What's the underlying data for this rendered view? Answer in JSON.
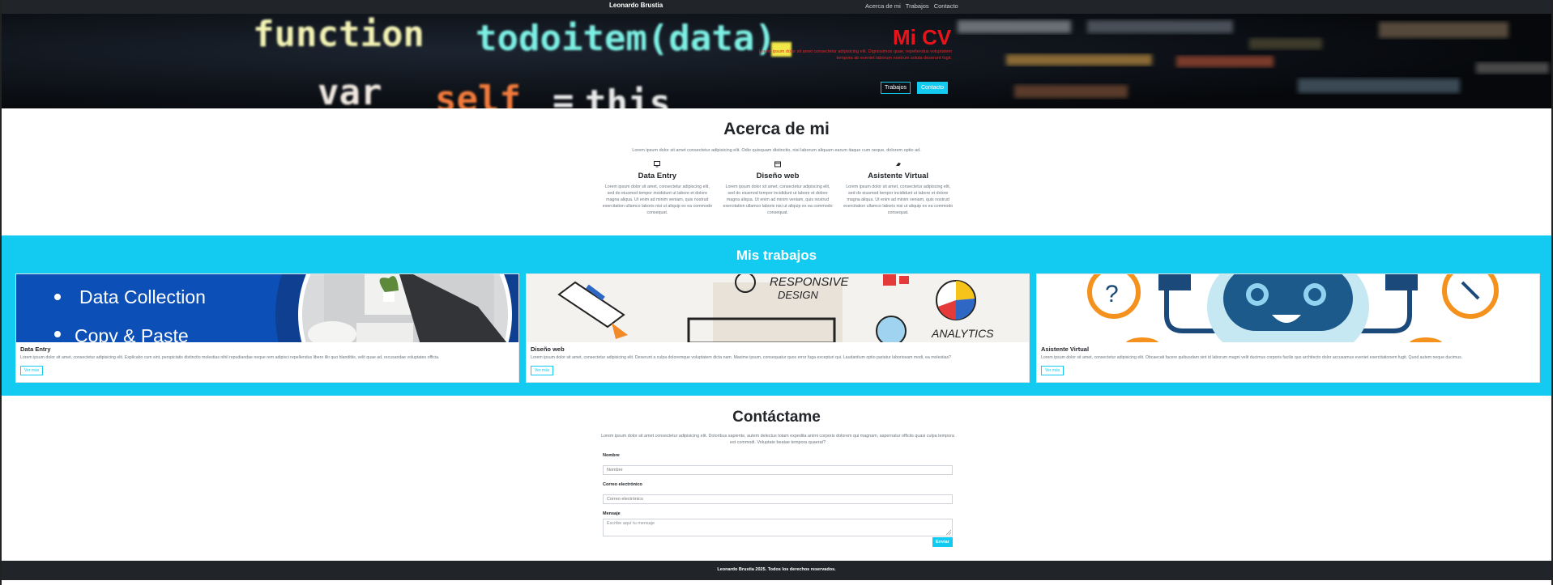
{
  "navbar": {
    "brand": "Leonardo Brustia",
    "links": [
      "Acerca de mi",
      "Trabajos",
      "Contacto"
    ]
  },
  "hero": {
    "background_code_words": [
      "function",
      "todoitem(data)",
      "var",
      "self",
      "=",
      "this"
    ],
    "title": "Mi CV",
    "text": "Lorem ipsum dolor sit amet consectetur adipisicing elit. Dignissimos quae, repellendus voluptatem tempora ab eveniet laborum nostrum soluta deserunt fugit.",
    "buttons": [
      "Trabajos",
      "Contacto"
    ],
    "accent_color": "#e8141c"
  },
  "about": {
    "title": "Acerca de mi",
    "lead": "Lorem ipsum dolor sit amet consectetur adipisicing elit. Odio quisquam distinctio, nisi laborum aliquam earum itaque cum neque, dolorem optio ad.",
    "features": [
      {
        "icon": "monitor-icon",
        "title": "Data Entry",
        "text": "Lorem ipsum dolor sit amet, consectetur adipiscing elit, sed do eiusmod tempor incididunt ut labore et dolore magna aliqua. Ut enim ad minim veniam, quis nostrud exercitation ullamco laboris nisi ut aliquip ex ea commodo consequat."
      },
      {
        "icon": "browser-window-icon",
        "title": "Diseño web",
        "text": "Lorem ipsum dolor sit amet, consectetur adipiscing elit, sed do eiusmod tempor incididunt ut labore et dolore magna aliqua. Ut enim ad minim veniam, quis nostrud exercitation ullamco laboris nisi ut aliquip ex ea commodo consequat."
      },
      {
        "icon": "robot-icon",
        "title": "Asistente Virtual",
        "text": "Lorem ipsum dolor sit amet, consectetur adipiscing elit, sed do eiusmod tempor incididunt ut labore et dolore magna aliqua. Ut enim ad minim veniam, quis nostrud exercitation ullamco laboris nisi ut aliquip ex ea commodo consequat."
      }
    ]
  },
  "works": {
    "title": "Mis trabajos",
    "accent_color": "#13caf0",
    "cards": [
      {
        "image_text": [
          "Data Collection",
          "Copy & Paste"
        ],
        "title": "Data Entry",
        "text": "Lorem ipsum dolor sit amet, consectetur adipisicing elit. Explicabo cum sint, perspiciatis distinctio molestias nihil repudiandae neque rem adipisci repellendus libero illo quo blanditiis, velit quae ad, recusandae voluptates officia.",
        "button": "Ver más"
      },
      {
        "image_text": [
          "RESPONSIVE",
          "DESIGN",
          "ANALYTICS"
        ],
        "title": "Diseño web",
        "text": "Lorem ipsum dolor sit amet, consectetur adipisicing elit. Deserunt a culpa doloremque voluptatem dicta nam. Maxime ipsum, consequatur quos error fuga excepturi qui. Laudantium optio pariatur laboriosam modi, ea molestias?",
        "button": "Ver más"
      },
      {
        "image_text": [],
        "title": "Asistente Virtual",
        "text": "Lorem ipsum dolor sit amet, consectetur adipisicing elit. Obcaecati facere quibusdam sint id laborum magni velit ducimus corporis facilis quo architecto dolor accusamus eveniet exercitationem fugit. Quod autem neque ducimus.",
        "button": "Ver más"
      }
    ]
  },
  "contact": {
    "title": "Contáctame",
    "lead": "Lorem ipsum dolor sit amet consectetur adipisicing elit. Doloribus sapiente, autem delectus totam expedita animi corporis dolorem qui magnam, aspernatur officiis quasi culpa tempora est commodi. Voluptate beatae tempora quaerat?",
    "fields": [
      {
        "label": "Nombre",
        "placeholder": "Nombre"
      },
      {
        "label": "Correo electrónico",
        "placeholder": "Correo electrónico"
      },
      {
        "label": "Mensaje",
        "placeholder": "Escribe aquí tu mensaje"
      }
    ],
    "submit": "Enviar"
  },
  "footer": {
    "text": "Leonardo Brustia 2025. Todos los derechos reservados."
  }
}
